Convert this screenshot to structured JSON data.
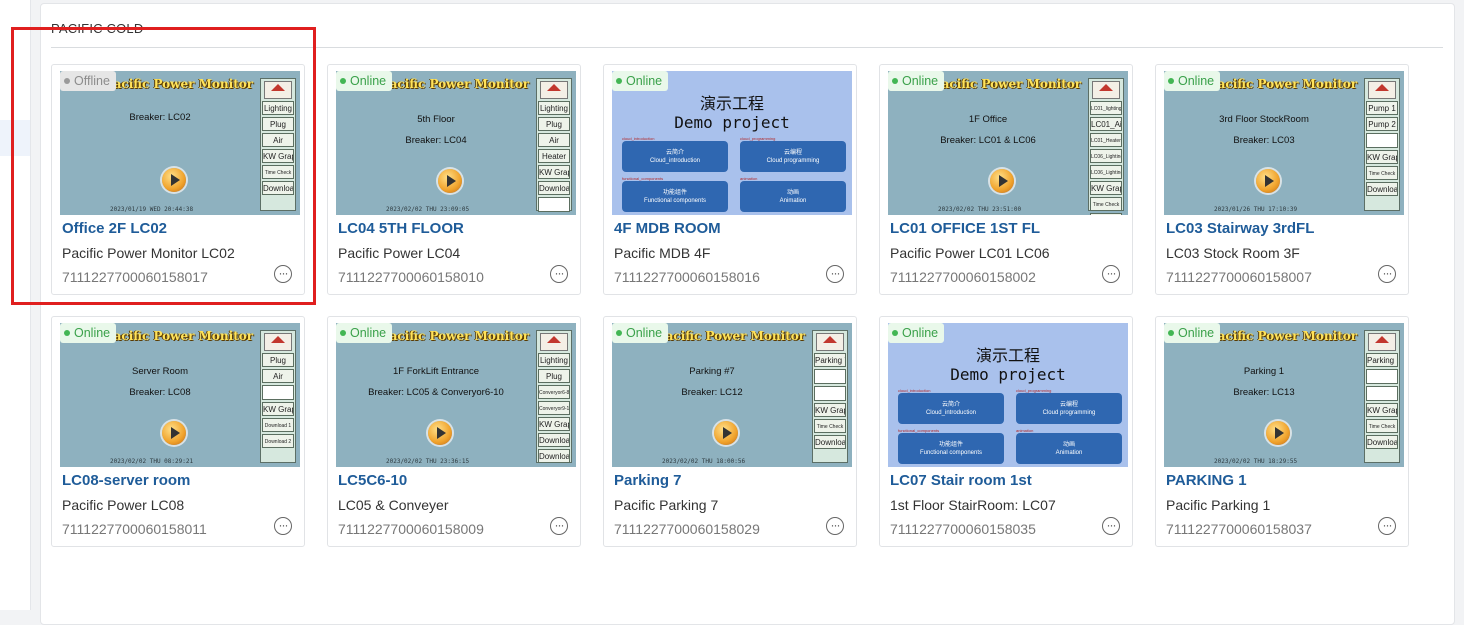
{
  "group": {
    "title": "PACIFIC COLD"
  },
  "status": {
    "online": "Online",
    "offline": "Offline"
  },
  "more_icon": "ellipsis-circle-icon",
  "cards": [
    {
      "status": "Offline",
      "name": "Office 2F LC02",
      "desc": "Pacific Power Monitor LC02",
      "sn": "7111227700060158017",
      "thumb": {
        "type": "monitor",
        "title": "Pacific Power Monitor",
        "line1": "",
        "line2": "Breaker:  LC02",
        "date": "2023/01/19  WED 20:44:38",
        "buttons": [
          "Lighting",
          "Plug",
          "Air",
          "KW Graph",
          "Time Check",
          "Download"
        ]
      }
    },
    {
      "status": "Online",
      "name": "LC04 5TH FLOOR",
      "desc": "Pacific Power LC04",
      "sn": "7111227700060158010",
      "thumb": {
        "type": "monitor",
        "title": "Pacific Power Monitor",
        "line1": "5th Floor",
        "line2": "Breaker:  LC04",
        "date": "2023/02/02  THU 23:09:05",
        "buttons": [
          "Lighting",
          "Plug",
          "Air",
          "Heater",
          "KW Graph",
          "Download",
          ""
        ]
      }
    },
    {
      "status": "Online",
      "name": "4F MDB ROOM",
      "desc": "Pacific MDB 4F",
      "sn": "7111227700060158016",
      "thumb": {
        "type": "demo",
        "head1": "演示工程",
        "head2": "Demo project",
        "boxes": [
          {
            "t1": "云简介",
            "t2": "Cloud_introduction",
            "lbl": "cloud_introduction"
          },
          {
            "t1": "云编程",
            "t2": "Cloud programming",
            "lbl": "cloud_programming"
          },
          {
            "t1": "功能组件",
            "t2": "Functional components",
            "lbl": "functional_components"
          },
          {
            "t1": "动画",
            "t2": "Animation",
            "lbl": "animation"
          }
        ]
      }
    },
    {
      "status": "Online",
      "name": "LC01 OFFICE 1ST FL",
      "desc": "Pacific Power LC01 LC06",
      "sn": "7111227700060158002",
      "thumb": {
        "type": "monitor",
        "title": "Pacific Power Monitor",
        "line1": "1F Office",
        "line2": "Breaker:  LC01 & LC06",
        "date": "2023/02/02  THU 23:51:00",
        "buttons": [
          "LC01_lighting",
          "LC01_Air",
          "LC01_Heater",
          "LC06_Lighting1",
          "LC06_Lighting2",
          "KW Graph",
          "Time Check",
          "Download"
        ]
      }
    },
    {
      "status": "Online",
      "name": "LC03 Stairway 3rdFL",
      "desc": "LC03 Stock Room 3F",
      "sn": "7111227700060158007",
      "thumb": {
        "type": "monitor",
        "title": "Pacific Power Monitor",
        "line1": "3rd Floor StockRoom",
        "line2": "Breaker:  LC03",
        "date": "2023/01/26  THU 17:10:39",
        "buttons": [
          "Pump 1",
          "Pump 2",
          "",
          "KW Graph",
          "Time Check",
          "Download"
        ]
      }
    },
    {
      "status": "Online",
      "name": "LC08-server room",
      "desc": "Pacific Power LC08",
      "sn": "7111227700060158011",
      "thumb": {
        "type": "monitor",
        "title": "Pacific Power Monitor",
        "line1": "Server Room",
        "line2": "Breaker:  LC08",
        "date": "2023/02/02  THU 08:29:21",
        "buttons": [
          "Plug",
          "Air",
          "",
          "KW Graph",
          "Download 1",
          "Download 2"
        ]
      }
    },
    {
      "status": "Online",
      "name": "LC5C6-10",
      "desc": "LC05 & Conveyer",
      "sn": "7111227700060158009",
      "thumb": {
        "type": "monitor",
        "title": "Pacific Power Monitor",
        "line1": "1F ForkLift Entrance",
        "line2": "Breaker:  LC05 & Converyor6-10",
        "date": "2023/02/02  THU 23:36:15",
        "buttons": [
          "Lighting",
          "Plug",
          "Converyor6-8",
          "Converyor9-10",
          "KW Graph",
          "Download",
          "Download"
        ]
      }
    },
    {
      "status": "Online",
      "name": "Parking 7",
      "desc": "Pacific Parking 7",
      "sn": "7111227700060158029",
      "thumb": {
        "type": "monitor",
        "title": "Pacific Power Monitor",
        "line1": "Parking #7",
        "line2": "Breaker: LC12",
        "date": "2023/02/02  THU 18:00:56",
        "buttons": [
          "Parking 7",
          "",
          "",
          "KW Graph",
          "Time Check",
          "Download"
        ]
      }
    },
    {
      "status": "Online",
      "name": "LC07 Stair room 1st",
      "desc": "1st Floor StairRoom: LC07",
      "sn": "7111227700060158035",
      "thumb": {
        "type": "demo",
        "head1": "演示工程",
        "head2": "Demo project",
        "boxes": [
          {
            "t1": "云简介",
            "t2": "Cloud_introduction",
            "lbl": "cloud_introduction"
          },
          {
            "t1": "云编程",
            "t2": "Cloud programming",
            "lbl": "cloud_programming"
          },
          {
            "t1": "功能组件",
            "t2": "Functional components",
            "lbl": "functional_components"
          },
          {
            "t1": "动画",
            "t2": "Animation",
            "lbl": "animation"
          }
        ]
      }
    },
    {
      "status": "Online",
      "name": "PARKING 1",
      "desc": "Pacific Parking 1",
      "sn": "7111227700060158037",
      "thumb": {
        "type": "monitor",
        "title": "Pacific Power Monitor",
        "line1": "Parking 1",
        "line2": "Breaker: LC13",
        "date": "2023/02/02  THU 18:29:55",
        "buttons": [
          "Parking 1",
          "",
          "",
          "KW Graph",
          "Time Check",
          "Download"
        ]
      }
    }
  ]
}
